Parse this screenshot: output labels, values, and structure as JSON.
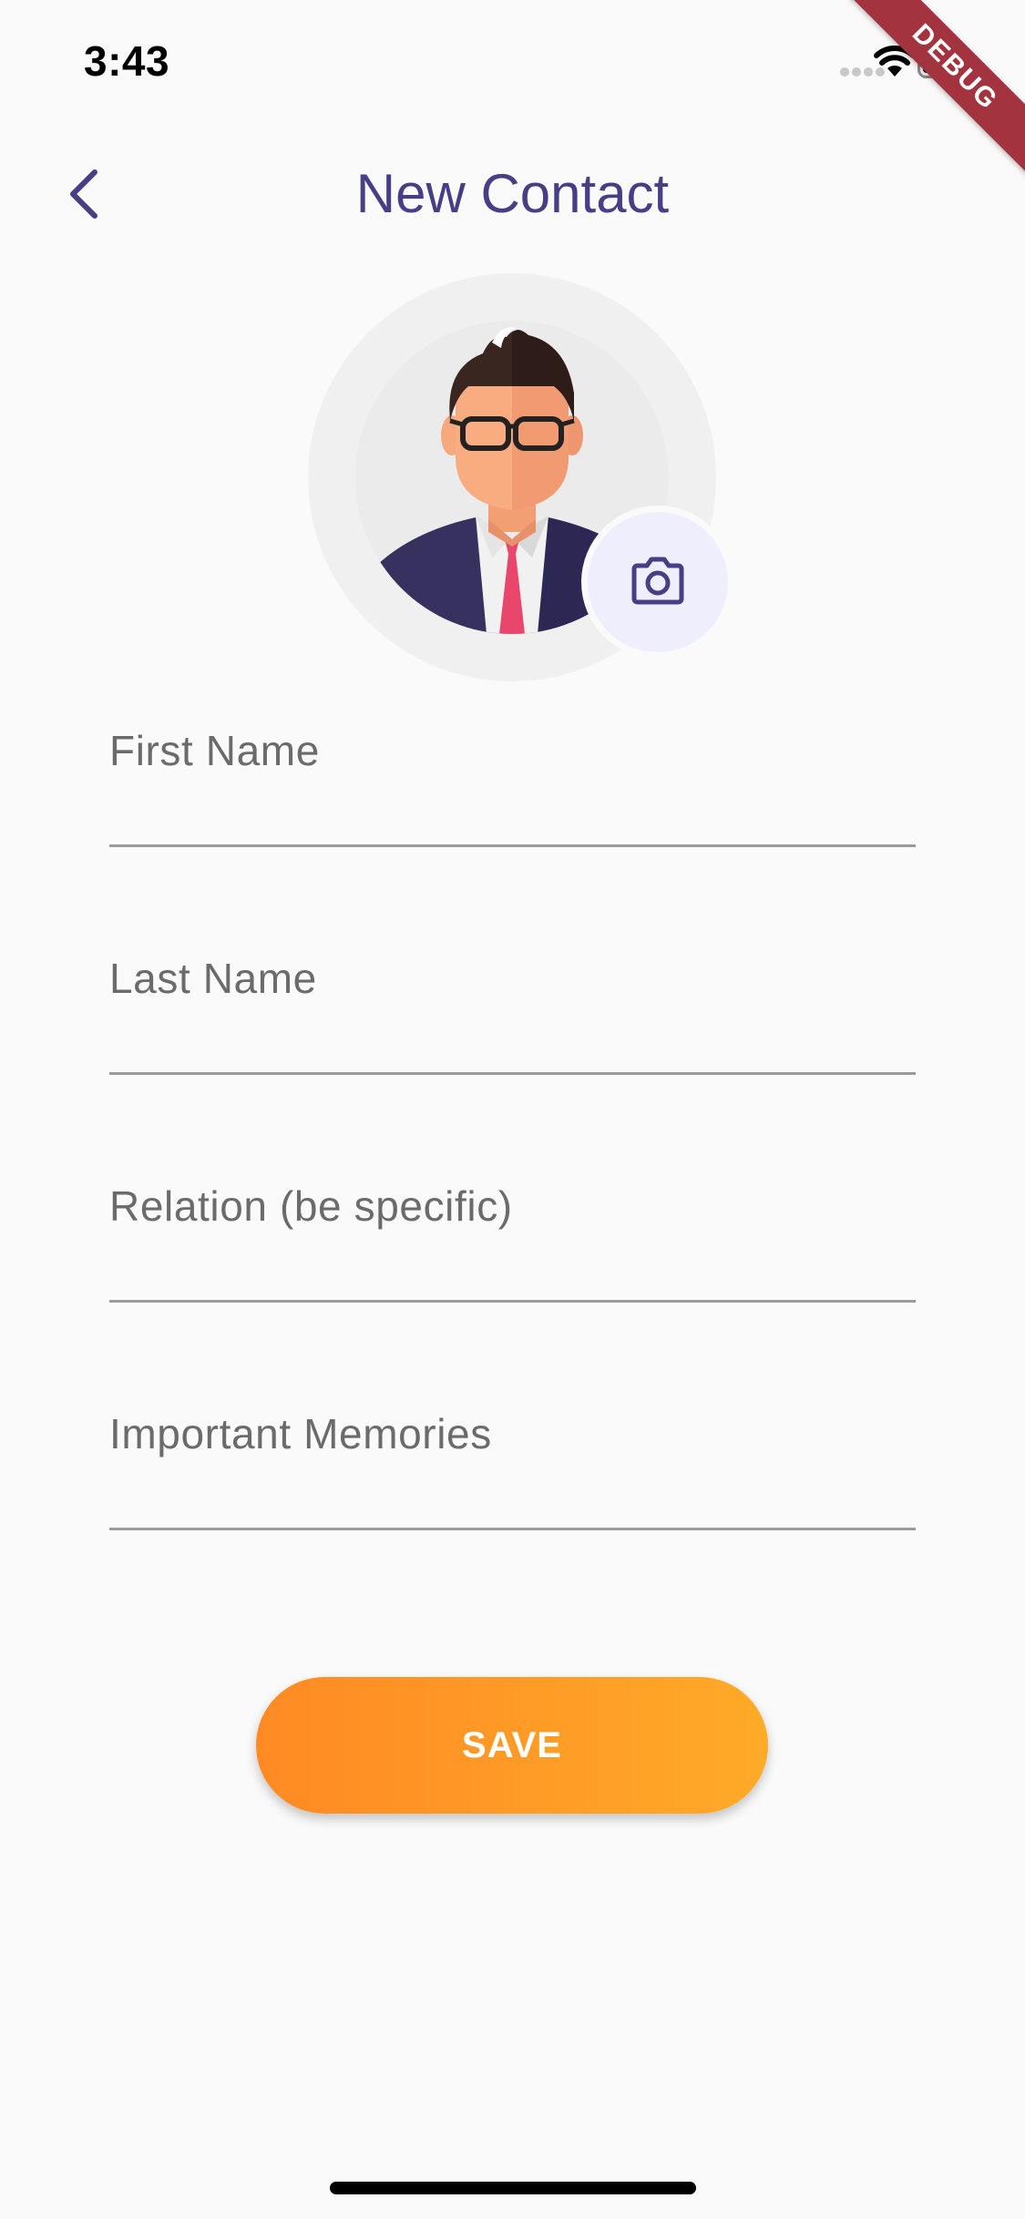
{
  "status_bar": {
    "time": "3:43",
    "icons": [
      "signal-icon",
      "wifi-icon",
      "battery-icon"
    ]
  },
  "debug_banner": {
    "label": "DEBUG"
  },
  "header": {
    "title": "New Contact",
    "back_icon": "chevron-left-icon"
  },
  "avatar": {
    "icon": "person-avatar-icon",
    "camera_icon": "camera-icon"
  },
  "form": {
    "fields": [
      {
        "label": "First Name",
        "value": ""
      },
      {
        "label": "Last Name",
        "value": ""
      },
      {
        "label": "Relation (be specific)",
        "value": ""
      },
      {
        "label": "Important Memories",
        "value": ""
      }
    ]
  },
  "actions": {
    "save_label": "SAVE"
  },
  "colors": {
    "primary": "#463f86",
    "accent_start": "#ff8a24",
    "accent_end": "#ffaa28",
    "background": "#fafafa",
    "debug_ribbon": "#a3343f"
  }
}
